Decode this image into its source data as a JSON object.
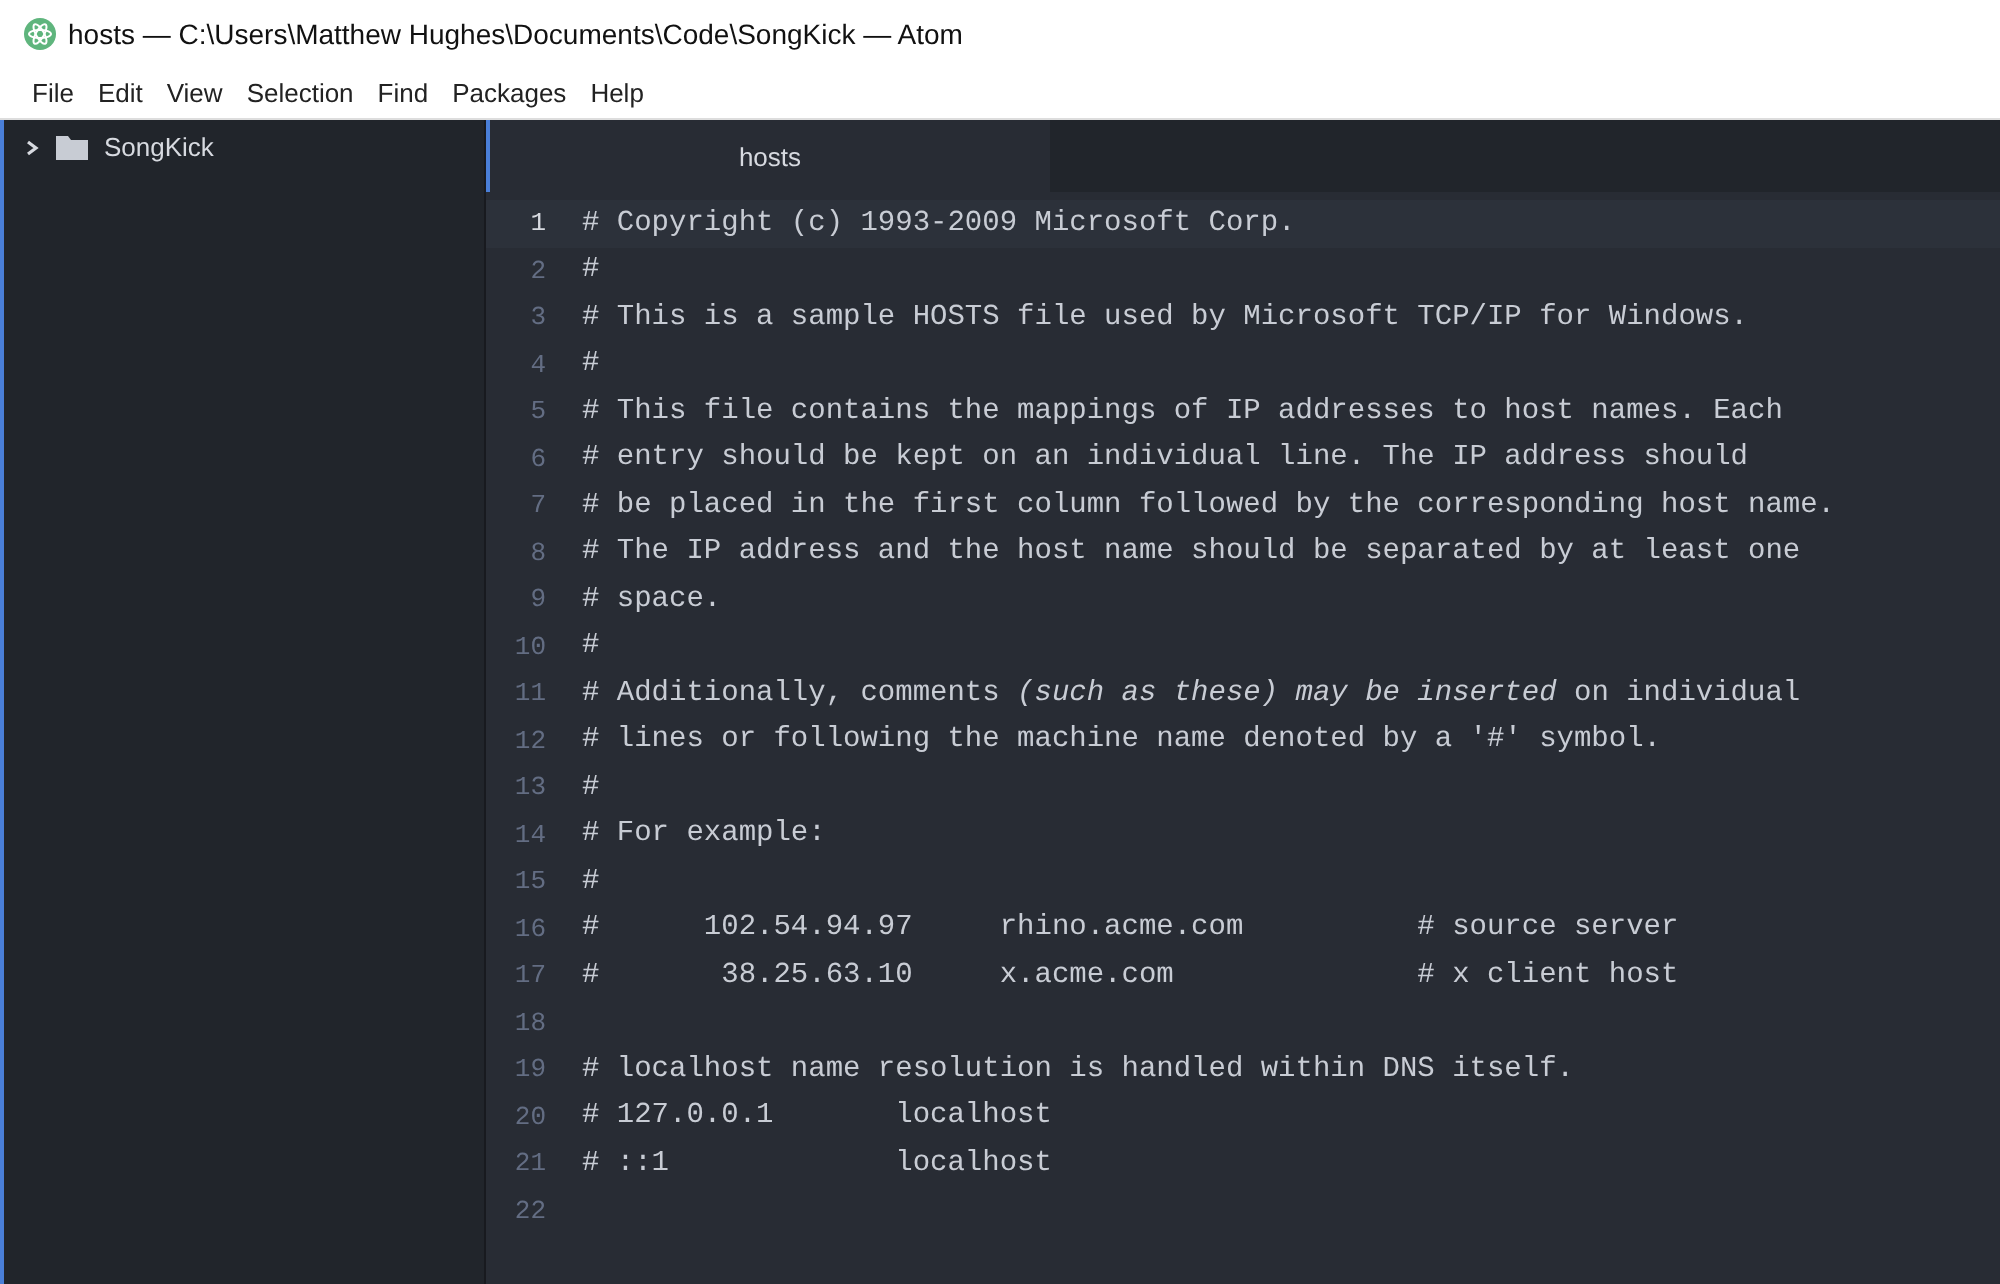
{
  "window": {
    "title": "hosts — C:\\Users\\Matthew Hughes\\Documents\\Code\\SongKick — Atom"
  },
  "menu": [
    "File",
    "Edit",
    "View",
    "Selection",
    "Find",
    "Packages",
    "Help"
  ],
  "tree": {
    "items": [
      {
        "label": "SongKick",
        "expanded": false
      }
    ]
  },
  "tabs": [
    {
      "label": "hosts",
      "selected": true
    }
  ],
  "editor": {
    "lines": [
      {
        "number": "1",
        "text": "# Copyright (c) 1993-2009 Microsoft Corp.",
        "current": true
      },
      {
        "number": "2",
        "text": "#",
        "current": false
      },
      {
        "number": "3",
        "text": "# This is a sample HOSTS file used by Microsoft TCP/IP for Windows.",
        "current": false
      },
      {
        "number": "4",
        "text": "#",
        "current": false
      },
      {
        "number": "5",
        "text": "# This file contains the mappings of IP addresses to host names. Each",
        "current": false
      },
      {
        "number": "6",
        "text": "# entry should be kept on an individual line. The IP address should",
        "current": false
      },
      {
        "number": "7",
        "text": "# be placed in the first column followed by the corresponding host name.",
        "current": false
      },
      {
        "number": "8",
        "text": "# The IP address and the host name should be separated by at least one",
        "current": false
      },
      {
        "number": "9",
        "text": "# space.",
        "current": false
      },
      {
        "number": "10",
        "text": "#",
        "current": false
      },
      {
        "number": "11",
        "text": "# Additionally, comments *(such as these) may be inserted* on individual",
        "current": false
      },
      {
        "number": "12",
        "text": "# lines or following the machine name denoted by a '#' symbol.",
        "current": false
      },
      {
        "number": "13",
        "text": "#",
        "current": false
      },
      {
        "number": "14",
        "text": "# For example:",
        "current": false
      },
      {
        "number": "15",
        "text": "#",
        "current": false
      },
      {
        "number": "16",
        "text": "#      102.54.94.97     rhino.acme.com          # source server",
        "current": false
      },
      {
        "number": "17",
        "text": "#       38.25.63.10     x.acme.com              # x client host",
        "current": false
      },
      {
        "number": "18",
        "current": false
      },
      {
        "number": "19",
        "text": "# localhost name resolution is handled within DNS itself.",
        "current": false
      },
      {
        "number": "20",
        "text": "# 127.0.0.1       localhost",
        "current": false
      },
      {
        "number": "21",
        "text": "# ::1             localhost",
        "current": false
      },
      {
        "number": "22",
        "current": false
      }
    ]
  }
}
